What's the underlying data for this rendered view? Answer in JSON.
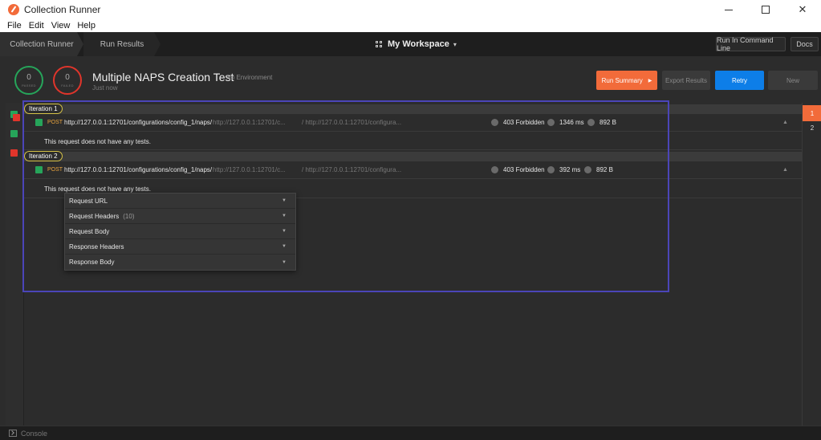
{
  "window": {
    "title": "Collection Runner",
    "minimize": "",
    "maximize": "",
    "close": "✕"
  },
  "menu": [
    "File",
    "Edit",
    "View",
    "Help"
  ],
  "topbar": {
    "breadcrumbs": [
      "Collection Runner",
      "Run Results"
    ],
    "workspace": "My Workspace",
    "run_cli": "Run In Command Line",
    "docs": "Docs"
  },
  "summary": {
    "passed_count": "0",
    "passed_label": "PASSED",
    "failed_count": "0",
    "failed_label": "FAILED",
    "title": "Multiple NAPS Creation Test",
    "environment": "No Environment",
    "time": "Just now",
    "run_summary": "Run Summary",
    "export_results": "Export Results",
    "retry": "Retry",
    "new": "New"
  },
  "iterations": [
    {
      "label": "Iteration 1",
      "method": "POST",
      "url": "http://127.0.0.1:12701/configurations/config_1/naps/",
      "url_dim_1": "http://127.0.0.1:12701/c...",
      "url_dim_2": "/ http://127.0.0.1:12701/configura...",
      "status": "403 Forbidden",
      "time": "1346 ms",
      "size": "892 B",
      "test_note": "This request does not have any tests."
    },
    {
      "label": "Iteration 2",
      "method": "POST",
      "url": "http://127.0.0.1:12701/configurations/config_1/naps/",
      "url_dim_1": "http://127.0.0.1:12701/c...",
      "url_dim_2": "/ http://127.0.0.1:12701/configura...",
      "status": "403 Forbidden",
      "time": "392 ms",
      "size": "892 B",
      "test_note": "This request does not have any tests."
    }
  ],
  "details": [
    {
      "label": "Request URL",
      "count": ""
    },
    {
      "label": "Request Headers",
      "count": "(10)"
    },
    {
      "label": "Request Body",
      "count": ""
    },
    {
      "label": "Response Headers",
      "count": ""
    },
    {
      "label": "Response Body",
      "count": ""
    }
  ],
  "iteration_tabs": [
    "1",
    "2"
  ],
  "bottom": {
    "console": "Console"
  },
  "colors": {
    "accent": "#f26b3a",
    "retry": "#0d7ee8",
    "pass": "#26a55a",
    "fail": "#e0352b",
    "highlight": "#4b45b8"
  }
}
